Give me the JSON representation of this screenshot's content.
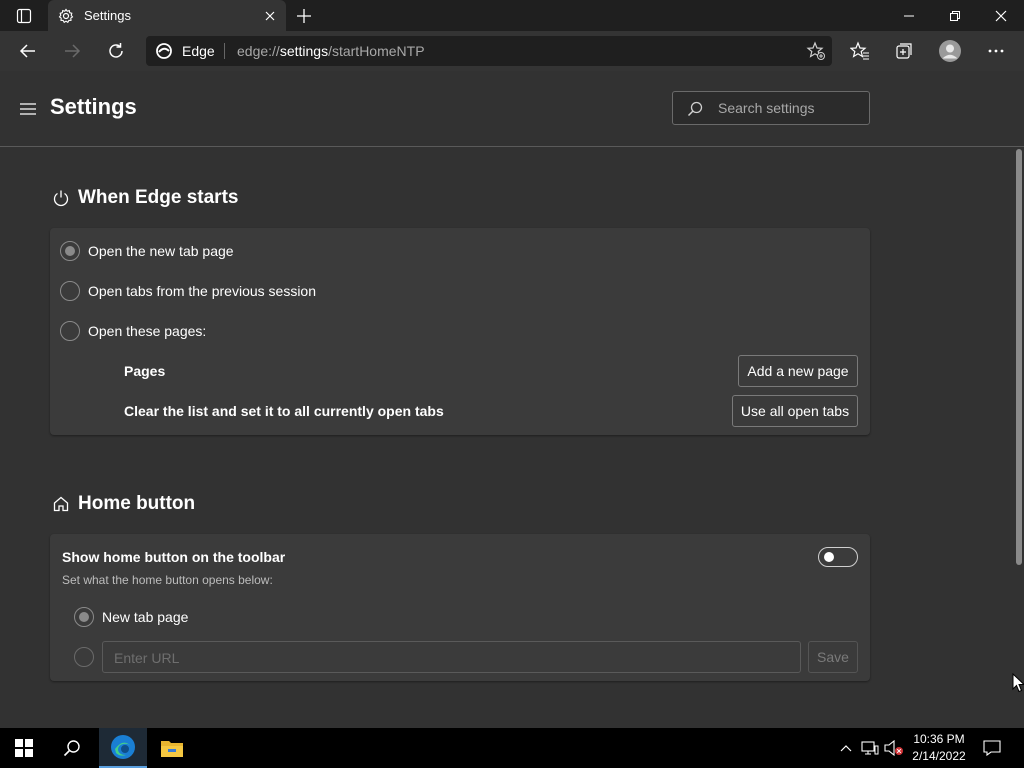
{
  "browser": {
    "tab_title": "Settings",
    "site_label": "Edge",
    "url_prefix": "edge://",
    "url_highlight": "settings",
    "url_suffix": "/startHomeNTP"
  },
  "header": {
    "title": "Settings",
    "search_placeholder": "Search settings"
  },
  "startup": {
    "title": "When Edge starts",
    "options": [
      {
        "label": "Open the new tab page",
        "checked": true
      },
      {
        "label": "Open tabs from the previous session",
        "checked": false
      },
      {
        "label": "Open these pages:",
        "checked": false
      }
    ],
    "pages_label": "Pages",
    "add_page_button": "Add a new page",
    "clear_label": "Clear the list and set it to all currently open tabs",
    "use_open_tabs_button": "Use all open tabs"
  },
  "home": {
    "title": "Home button",
    "toggle_label": "Show home button on the toolbar",
    "toggle_on": false,
    "subtitle": "Set what the home button opens below:",
    "option_new_tab": "New tab page",
    "url_placeholder": "Enter URL",
    "save_button": "Save"
  },
  "taskbar": {
    "time": "10:36 PM",
    "date": "2/14/2022"
  },
  "colors": {
    "page_bg": "#323232",
    "card_bg": "#3b3b3b",
    "tab_bar_bg": "#1f1f1f",
    "taskbar_bg": "#000000"
  }
}
